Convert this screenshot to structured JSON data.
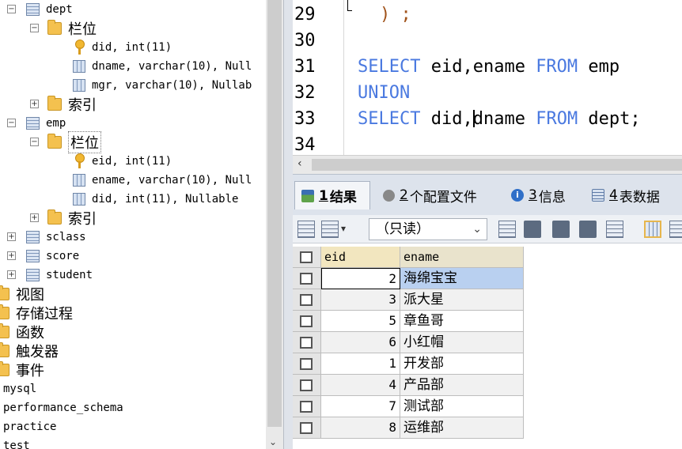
{
  "tree": {
    "dept_table": "dept",
    "dept_columns_folder": "栏位",
    "dept_columns": [
      "did, int(11)",
      "dname, varchar(10), Null",
      "mgr, varchar(10), Nullab"
    ],
    "dept_index_folder": "索引",
    "emp_table": "emp",
    "emp_columns_folder": "栏位",
    "emp_columns": [
      "eid, int(11)",
      "ename, varchar(10), Null",
      "did, int(11), Nullable"
    ],
    "emp_index_folder": "索引",
    "tables": [
      "sclass",
      "score",
      "student"
    ],
    "folders": [
      "视图",
      "存储过程",
      "函数",
      "触发器",
      "事件"
    ],
    "databases": [
      "mysql",
      "performance_schema",
      "practice",
      "test"
    ]
  },
  "editor": {
    "line_numbers": [
      "29",
      "30",
      "31",
      "32",
      "33",
      "34"
    ],
    "line29_code": ") ;",
    "line31_kw1": "SELECT",
    "line31_cols": " eid,ename ",
    "line31_kw2": "FROM",
    "line31_table": " emp",
    "line32_kw": "UNION",
    "line33_kw1": "SELECT",
    "line33_col1": " did,",
    "line33_col2": "dname ",
    "line33_kw2": "FROM",
    "line33_table": " dept;"
  },
  "result_tabs": [
    {
      "num": "1",
      "label": "结果"
    },
    {
      "num": "2",
      "label": "个配置文件"
    },
    {
      "num": "3",
      "label": "信息"
    },
    {
      "num": "4",
      "label": "表数据"
    }
  ],
  "toolbar": {
    "mode_select": "（只读）"
  },
  "grid": {
    "columns": [
      "eid",
      "ename"
    ],
    "rows": [
      {
        "eid": "2",
        "ename": "海绵宝宝"
      },
      {
        "eid": "3",
        "ename": "派大星"
      },
      {
        "eid": "5",
        "ename": "章鱼哥"
      },
      {
        "eid": "6",
        "ename": "小红帽"
      },
      {
        "eid": "1",
        "ename": "开发部"
      },
      {
        "eid": "4",
        "ename": "产品部"
      },
      {
        "eid": "7",
        "ename": "测试部"
      },
      {
        "eid": "8",
        "ename": "运维部"
      }
    ]
  }
}
